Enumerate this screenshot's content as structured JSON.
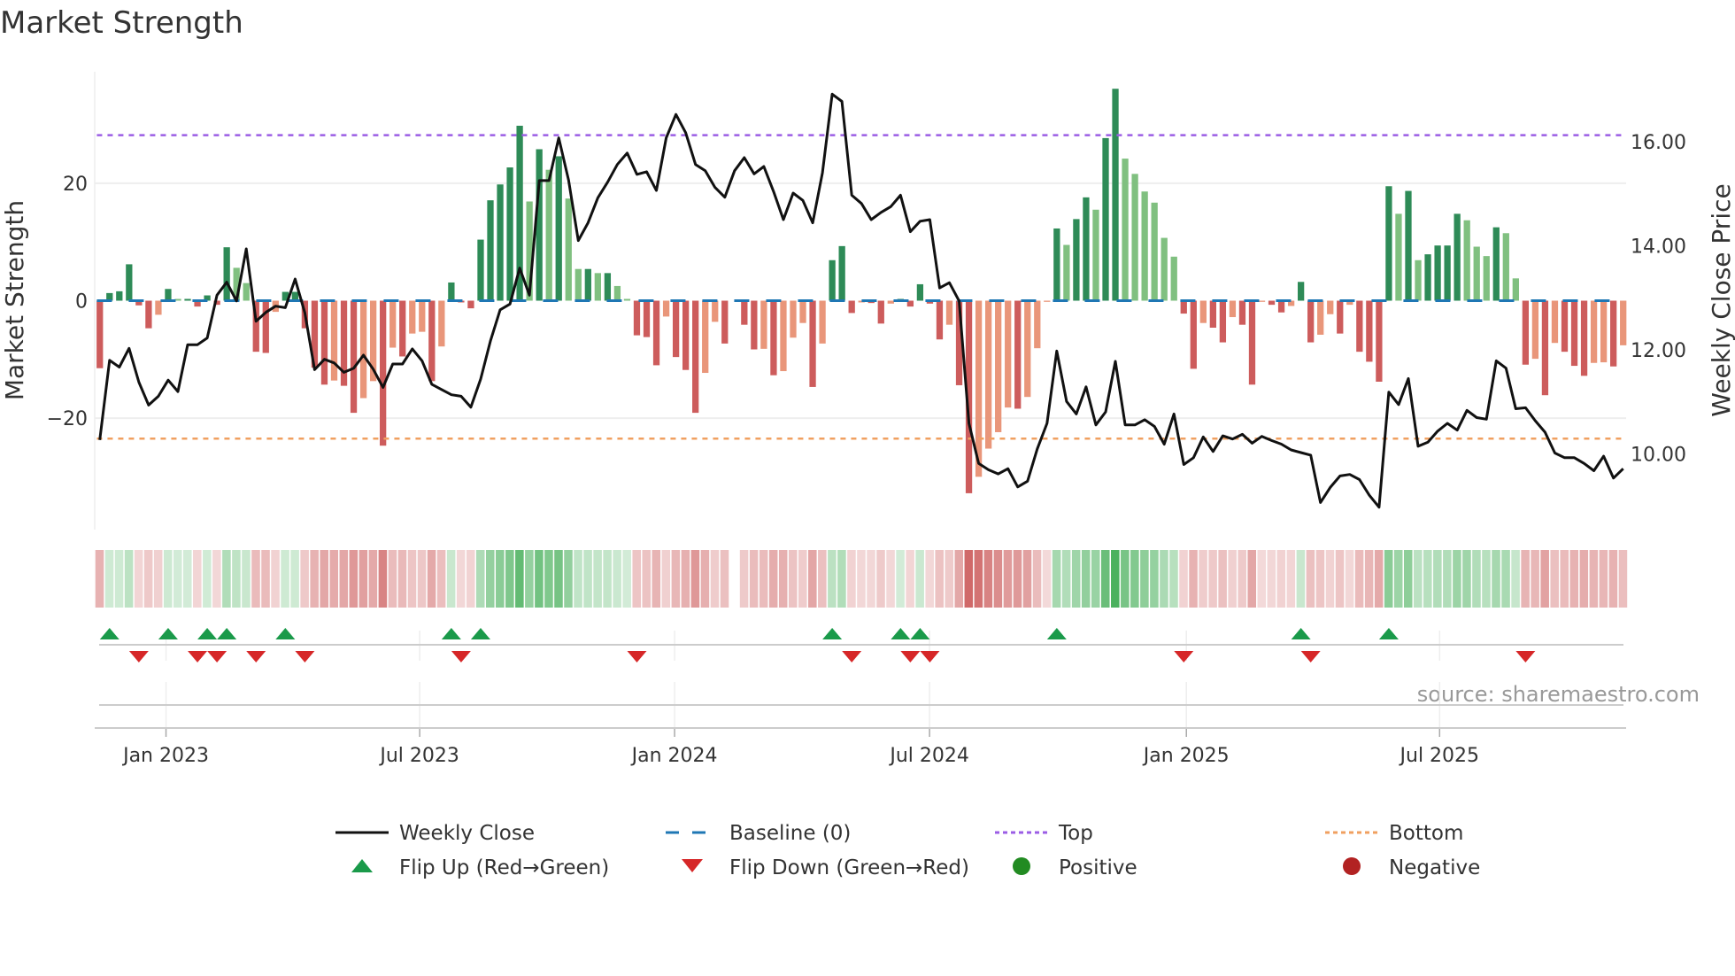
{
  "chart_data": {
    "type": "bar",
    "title": "Market Strength",
    "ylabel": "Market Strength",
    "y2label": "Weekly Close Price",
    "ylim": [
      -39,
      39
    ],
    "y2lim": [
      8.55,
      17.34
    ],
    "xlim": [
      -0.52,
      156.3
    ],
    "grid": true,
    "yticks": [
      {
        "value": 20,
        "label": "20"
      },
      {
        "value": 0,
        "label": "0"
      },
      {
        "value": -20,
        "label": "−20"
      }
    ],
    "y2ticks": [
      {
        "value": 16,
        "label": "16.00"
      },
      {
        "value": 14,
        "label": "14.00"
      },
      {
        "value": 12,
        "label": "12.00"
      },
      {
        "value": 10,
        "label": "10.00"
      }
    ],
    "xticks": [
      {
        "week": 6.78,
        "label": "Jan 2023"
      },
      {
        "week": 32.76,
        "label": "Jul 2023"
      },
      {
        "week": 58.86,
        "label": "Jan 2024"
      },
      {
        "week": 84.97,
        "label": "Jul 2024"
      },
      {
        "week": 111.27,
        "label": "Jan 2025"
      },
      {
        "week": 137.2,
        "label": "Jul 2025"
      }
    ],
    "top_level": 28.2,
    "bottom_level": -23.5,
    "baseline": 0,
    "strength": [
      -11.5,
      1.3,
      1.6,
      6.2,
      -0.8,
      -4.7,
      -2.4,
      2.0,
      0.3,
      0.3,
      -1.0,
      0.9,
      -0.7,
      9.1,
      5.6,
      3.0,
      -8.7,
      -8.9,
      -1.9,
      1.5,
      1.5,
      -4.7,
      -11.4,
      -14.3,
      -13.6,
      -14.5,
      -19.1,
      -16.6,
      -13.7,
      -24.7,
      -8.0,
      -9.5,
      -5.6,
      -5.3,
      -13.7,
      -7.8,
      3.1,
      -0.3,
      -1.3,
      10.4,
      17.1,
      19.8,
      22.7,
      29.8,
      16.9,
      25.8,
      22.3,
      24.6,
      17.4,
      5.4,
      5.4,
      4.7,
      4.7,
      2.5,
      0.3,
      -5.9,
      -6.2,
      -11.0,
      -2.7,
      -9.6,
      -11.8,
      -19.1,
      -12.3,
      -3.6,
      -7.3,
      0,
      -4.1,
      -8.3,
      -8.2,
      -12.7,
      -12.0,
      -6.3,
      -3.8,
      -14.7,
      -7.3,
      6.9,
      9.3,
      -2.1,
      -0.3,
      -0.4,
      -3.9,
      -0.5,
      0.3,
      -1.0,
      2.8,
      -0.5,
      -6.6,
      -4.1,
      -14.4,
      -32.8,
      -30.0,
      -25.2,
      -22.4,
      -18.2,
      -18.4,
      -16.4,
      -8.1,
      -0.2,
      12.3,
      9.5,
      13.9,
      17.6,
      15.5,
      27.7,
      36.1,
      24.2,
      21.6,
      18.6,
      16.7,
      10.7,
      7.5,
      -2.2,
      -11.6,
      -3.8,
      -4.6,
      -7.1,
      -2.8,
      -4.1,
      -14.3,
      -0.2,
      -0.7,
      -2.0,
      -0.9,
      3.2,
      -7.1,
      -5.8,
      -2.3,
      -5.6,
      -0.7,
      -8.7,
      -10.4,
      -13.8,
      19.5,
      14.8,
      18.7,
      6.9,
      7.9,
      9.4,
      9.4,
      14.8,
      13.7,
      9.2,
      7.6,
      12.5,
      11.5,
      3.8,
      -10.9,
      -9.9,
      -16.1,
      -7.2,
      -8.7,
      -11.1,
      -12.8,
      -10.6,
      -10.5,
      -11.2,
      -7.6
    ],
    "weekly_close": [
      10.27,
      11.8,
      11.67,
      12.03,
      11.38,
      10.94,
      11.11,
      11.42,
      11.2,
      12.1,
      12.1,
      12.23,
      13.05,
      13.3,
      12.94,
      13.94,
      12.55,
      12.72,
      12.84,
      12.81,
      13.36,
      12.71,
      11.62,
      11.82,
      11.75,
      11.57,
      11.65,
      11.9,
      11.63,
      11.28,
      11.73,
      11.73,
      12.02,
      11.79,
      11.34,
      11.24,
      11.14,
      11.11,
      10.9,
      11.44,
      12.17,
      12.77,
      12.88,
      13.57,
      13.05,
      15.25,
      15.25,
      16.07,
      15.26,
      14.1,
      14.44,
      14.92,
      15.22,
      15.56,
      15.78,
      15.37,
      15.42,
      15.06,
      16.07,
      16.52,
      16.17,
      15.56,
      15.44,
      15.12,
      14.93,
      15.44,
      15.69,
      15.38,
      15.52,
      15.04,
      14.5,
      15.01,
      14.87,
      14.44,
      15.4,
      16.91,
      16.77,
      14.97,
      14.81,
      14.5,
      14.64,
      14.75,
      14.97,
      14.27,
      14.47,
      14.5,
      13.19,
      13.29,
      12.94,
      10.59,
      9.82,
      9.7,
      9.62,
      9.72,
      9.37,
      9.48,
      10.1,
      10.59,
      11.98,
      11.01,
      10.77,
      11.29,
      10.56,
      10.81,
      11.78,
      10.56,
      10.56,
      10.66,
      10.53,
      10.19,
      10.77,
      9.8,
      9.93,
      10.33,
      10.05,
      10.35,
      10.29,
      10.38,
      10.21,
      10.34,
      10.26,
      10.19,
      10.08,
      10.03,
      9.98,
      9.07,
      9.36,
      9.58,
      9.61,
      9.51,
      9.21,
      8.98,
      11.19,
      10.95,
      11.45,
      10.15,
      10.23,
      10.44,
      10.59,
      10.46,
      10.84,
      10.7,
      10.67,
      11.79,
      11.65,
      10.87,
      10.89,
      10.64,
      10.42,
      10.02,
      9.93,
      9.93,
      9.82,
      9.68,
      9.96,
      9.54,
      9.72
    ],
    "flip_up_weeks": [
      1,
      7,
      11,
      13,
      19,
      36,
      39,
      75,
      82,
      84,
      98,
      123,
      132
    ],
    "flip_down_weeks": [
      4,
      10,
      12,
      16,
      21,
      37,
      55,
      77,
      83,
      85,
      111,
      124,
      146
    ],
    "legend": {
      "placement": "bottom",
      "items": [
        {
          "key": "close",
          "label": "Weekly Close"
        },
        {
          "key": "baseline",
          "label": "Baseline (0)"
        },
        {
          "key": "top",
          "label": "Top"
        },
        {
          "key": "bottom",
          "label": "Bottom"
        },
        {
          "key": "flip_up",
          "label": "Flip Up (Red→Green)"
        },
        {
          "key": "flip_down",
          "label": "Flip Down (Green→Red)"
        },
        {
          "key": "positive",
          "label": "Positive"
        },
        {
          "key": "negative",
          "label": "Negative"
        }
      ]
    },
    "source": "source: sharemaestro.com"
  },
  "colors": {
    "pos_strong": "#2e8b57",
    "pos_weak": "#80c080",
    "neg_strong": "#cd5c5c",
    "neg_weak": "#e9967a",
    "baseline": "#1f77b4",
    "top": "#9b5de5",
    "bottom": "#f0a060",
    "close": "#111111",
    "flip_up": "#1a9a4a",
    "flip_down": "#d62728",
    "positive": "#228b22",
    "negative": "#b22222"
  }
}
